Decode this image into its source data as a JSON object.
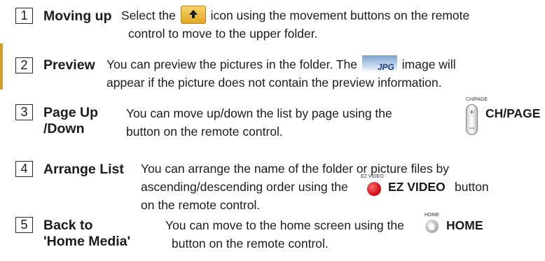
{
  "items": [
    {
      "number": "1",
      "term": "Moving up",
      "line1_a": "Select the",
      "line1_b": "icon using the movement buttons on the remote",
      "line2": "control to move to the upper folder.",
      "icon": "folder-up-icon"
    },
    {
      "number": "2",
      "term": "Preview",
      "line1_a": "You can preview the pictures in the folder. The",
      "line1_b": "image will",
      "line2": "appear if  the picture does not contain the preview information.",
      "icon": "jpg-thumbnail-icon",
      "icon_text": "JPG"
    },
    {
      "number": "3",
      "term_line1": "Page Up",
      "term_line2": "/Down",
      "line1_a": "You can move up/down the list by page using the",
      "button_caption": "CH/PAGE",
      "button_label": "CH/PAGE",
      "line2": "button on the remote control.",
      "icon": "ch-page-button-icon"
    },
    {
      "number": "4",
      "term": "Arrange List",
      "line1": "You can arrange the name of the folder or picture files by",
      "line2_a": "ascending/descending order using the",
      "button_caption": "EZ VIDEO",
      "button_label": "EZ VIDEO",
      "line2_b": "button",
      "line3": "on the remote control.",
      "icon": "ez-video-red-button-icon"
    },
    {
      "number": "5",
      "term_line1": "Back to",
      "term_line2": "'Home Media'",
      "line1_a": "You can move to the home screen using the",
      "button_caption": "HOME",
      "button_label": "HOME",
      "line2": "button on the remote control.",
      "icon": "home-button-icon"
    }
  ],
  "colors": {
    "text": "#1c1c1c",
    "accent_bar": "#c9a227",
    "ez_video_button": "#d4101b"
  }
}
